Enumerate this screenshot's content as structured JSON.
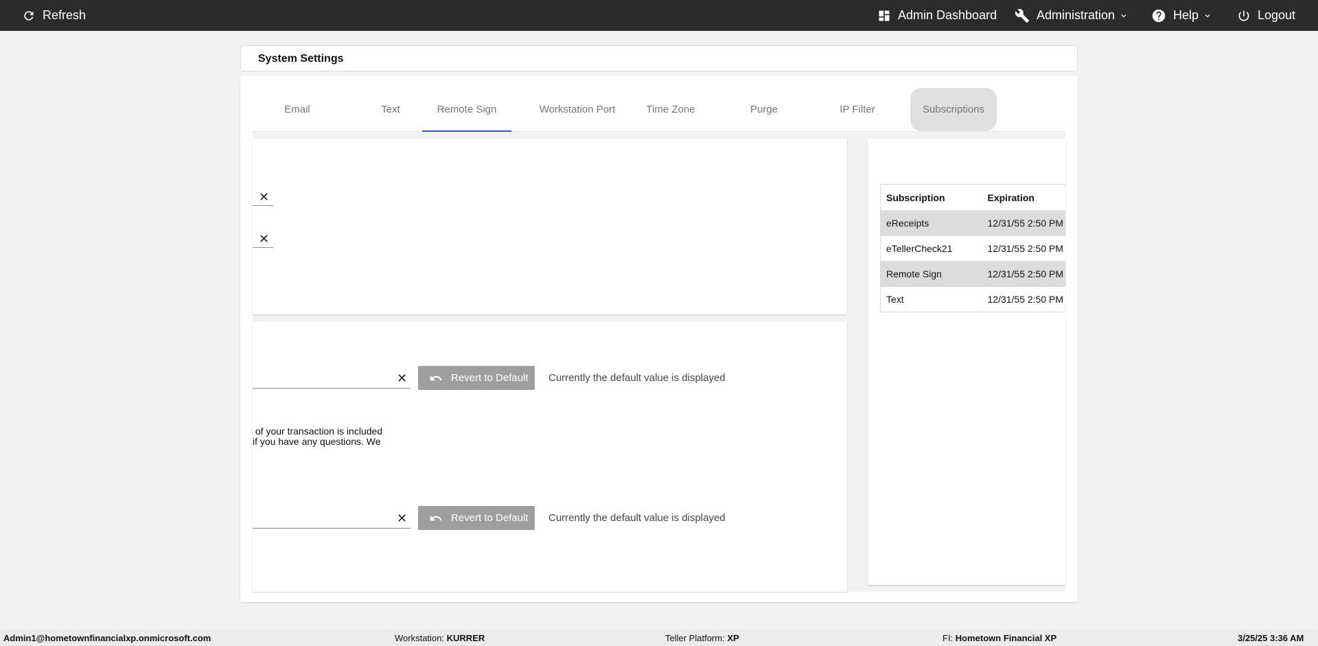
{
  "topbar": {
    "refresh_label": "Refresh",
    "admin_dashboard_label": "Admin Dashboard",
    "administration_label": "Administration",
    "help_label": "Help",
    "logout_label": "Logout"
  },
  "page": {
    "title": "System Settings"
  },
  "tabs": [
    {
      "label": "Email"
    },
    {
      "label": "Text"
    },
    {
      "label": "Remote Sign"
    },
    {
      "label": "Workstation Port"
    },
    {
      "label": "Time Zone"
    },
    {
      "label": "Purge"
    },
    {
      "label": "IP Filter"
    },
    {
      "label": "Subscriptions"
    }
  ],
  "active_tab": "Remote Sign",
  "hovered_tab": "Subscriptions",
  "settings": {
    "revert_label": "Revert to Default",
    "default_note": "Currently the default value is displayed",
    "message_line1": " of your transaction is included",
    "message_line2": "if you have any questions. We"
  },
  "subscriptions": {
    "headers": {
      "name": "Subscription",
      "expiration": "Expiration"
    },
    "rows": [
      {
        "name": "eReceipts",
        "expiration": "12/31/55 2:50 PM"
      },
      {
        "name": "eTellerCheck21",
        "expiration": "12/31/55 2:50 PM"
      },
      {
        "name": "Remote Sign",
        "expiration": "12/31/55 2:50 PM"
      },
      {
        "name": "Text",
        "expiration": "12/31/55 2:50 PM"
      }
    ]
  },
  "footer": {
    "user": "Admin1@hometownfinancialxp.onmicrosoft.com",
    "workstation_label": "Workstation:",
    "workstation_value": "KURRER",
    "platform_label": "Teller Platform:",
    "platform_value": "XP",
    "fi_label": "FI:",
    "fi_value": "Hometown Financial XP",
    "datetime": "3/25/25 3:36 AM"
  },
  "colors": {
    "topbar_bg": "#2b2b2b",
    "tab_active_underline": "#3f51b5",
    "revert_button_bg": "#9e9e9e"
  }
}
